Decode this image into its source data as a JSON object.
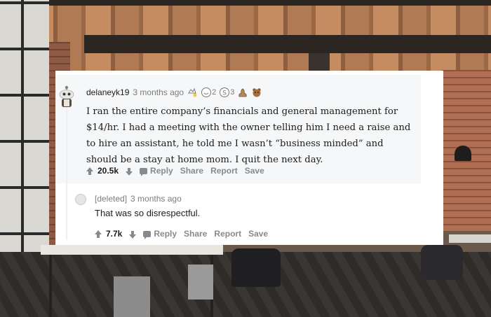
{
  "comment": {
    "author": "delaneyk19",
    "time": "3 months ago",
    "awards": [
      {
        "icon": "helpful-award-icon",
        "count": ""
      },
      {
        "icon": "wholesome-award-icon",
        "count": "2"
      },
      {
        "icon": "silver-award-icon",
        "count": "3"
      },
      {
        "icon": "poop-award-icon",
        "count": ""
      },
      {
        "icon": "bear-award-icon",
        "count": ""
      }
    ],
    "body": "I ran the entire company’s financials and general management for $14/hr. I had a meeting with the owner telling him I need a raise and to hire an assistant, he told me I wasn’t “business minded” and should be a stay at home mom. I quit the next day.",
    "votes": "20.5k",
    "actions": {
      "reply": "Reply",
      "share": "Share",
      "report": "Report",
      "save": "Save"
    }
  },
  "reply": {
    "author": "[deleted]",
    "time": "3 months ago",
    "body": "That was so disrespectful.",
    "votes": "7.7k",
    "actions": {
      "reply": "Reply",
      "share": "Share",
      "report": "Report",
      "save": "Save"
    }
  },
  "colors": {
    "card_bg": "#ffffff",
    "highlight_bg": "#f6f7f8",
    "text": "#1c1c1c",
    "muted": "#878a8c"
  }
}
